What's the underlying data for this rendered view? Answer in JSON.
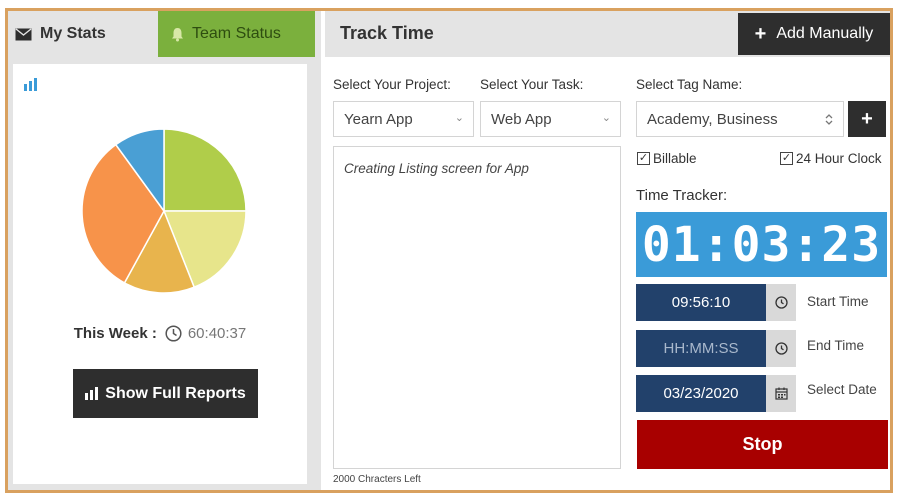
{
  "tabs": {
    "my_stats": "My Stats",
    "team_status": "Team Status"
  },
  "stats": {
    "week_label": "This Week :",
    "week_value": "60:40:37",
    "report_button": "Show Full Reports",
    "pie": [
      {
        "share": 25,
        "color": "#b0cd4a"
      },
      {
        "share": 19,
        "color": "#e7e58b"
      },
      {
        "share": 14,
        "color": "#e8b44d"
      },
      {
        "share": 32,
        "color": "#f7934a"
      },
      {
        "share": 10,
        "color": "#4a9fd4"
      }
    ]
  },
  "track": {
    "title": "Track Time",
    "add_button": "Add Manually",
    "project_label": "Select Your Project:",
    "project_value": "Yearn App",
    "task_label": "Select Your Task:",
    "task_value": "Web App",
    "tag_label": "Select Tag Name:",
    "tag_value": "Academy, Business",
    "description": "Creating Listing screen for App",
    "chars_left": "2000 Chracters Left",
    "billable_label": "Billable",
    "clock_label": "24 Hour Clock",
    "tracker_label": "Time Tracker:",
    "tracker_value": "01:03:23",
    "start_value": "09:56:10",
    "start_label": "Start Time",
    "end_value": "HH:MM:SS",
    "end_label": "End Time",
    "date_value": "03/23/2020",
    "date_label": "Select Date",
    "stop_button": "Stop"
  },
  "colors": {
    "accent_green": "#7bb03d",
    "tracker_blue": "#3a9bd8",
    "time_navy": "#22416b",
    "stop_red": "#a80000",
    "frame": "#d9a15f"
  }
}
